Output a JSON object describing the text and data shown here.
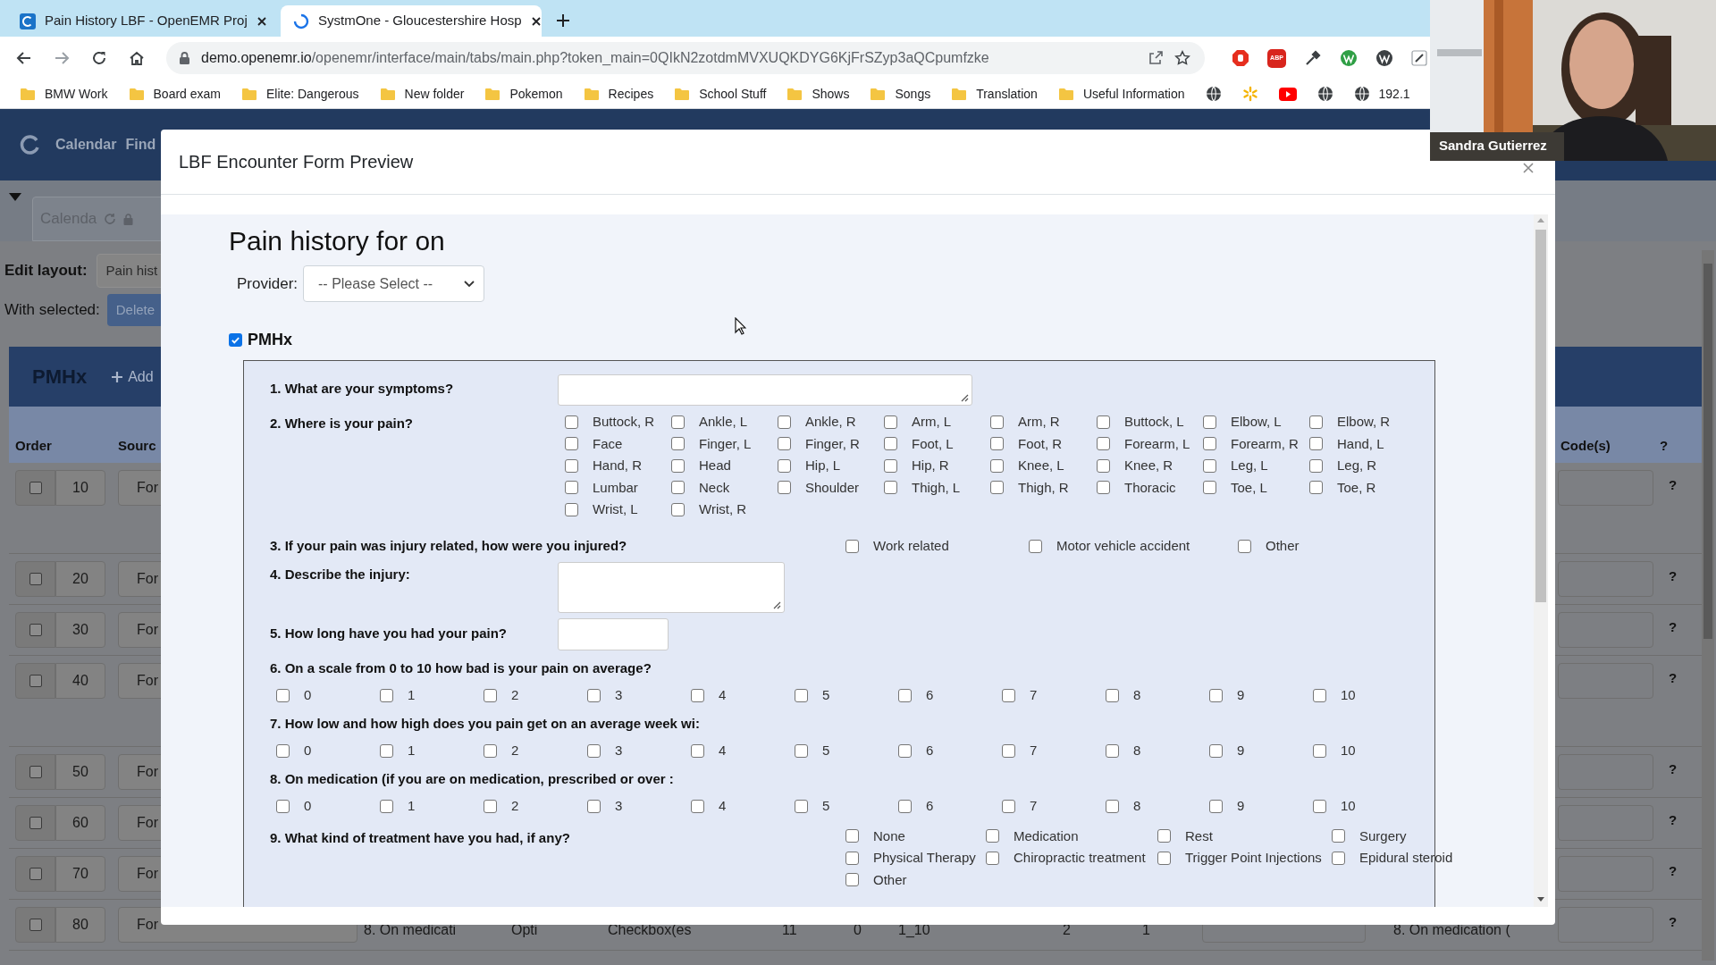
{
  "browser": {
    "tabs": [
      {
        "title": "Pain History LBF - OpenEMR Proj",
        "selected": false
      },
      {
        "title": "SystmOne - Gloucestershire Hosp",
        "selected": true
      }
    ],
    "url_host": "demo.openemr.io",
    "url_path": "/openemr/interface/main/tabs/main.php?token_main=0QIkN2zotdmMVXUQKDYG6KjFrSZyp3aQCpumfzke",
    "abp_label": "ABP",
    "bookmarks": [
      "BMW Work",
      "Board exam",
      "Elite: Dangerous",
      "New folder",
      "Pokemon",
      "Recipes",
      "School Stuff",
      "Shows",
      "Songs",
      "Translation",
      "Useful Information"
    ],
    "bookmark_trailing": "192.1"
  },
  "video": {
    "name": "Sandra Gutierrez"
  },
  "app": {
    "nav": [
      "Calendar",
      "Find"
    ],
    "tab": "Calenda",
    "edit_layout_label": "Edit layout:",
    "layout_select": "Pain hist",
    "with_selected_label": "With selected:",
    "delete_button": "Delete",
    "section_title": "PMHx",
    "add_button": "Add",
    "columns": [
      "Order",
      "Sourc",
      "Code(s)",
      "?"
    ],
    "rows": [
      {
        "order": "10",
        "source": "For",
        "help": "?",
        "tall": true,
        "checked": false
      },
      {
        "order": "20",
        "source": "For",
        "help": "?",
        "tall": false,
        "checked": false
      },
      {
        "order": "30",
        "source": "For",
        "help": "?",
        "tall": false,
        "checked": false
      },
      {
        "order": "40",
        "source": "For",
        "help": "?",
        "tall": true,
        "checked": false
      },
      {
        "order": "50",
        "source": "For",
        "help": "?",
        "tall": false,
        "checked": false
      },
      {
        "order": "60",
        "source": "For",
        "help": "?",
        "tall": false,
        "checked": false
      },
      {
        "order": "70",
        "source": "For",
        "help": "?",
        "tall": false,
        "checked": false
      },
      {
        "order": "80",
        "source": "For",
        "help": "?",
        "tall": false,
        "checked": false,
        "more_cells": [
          "8. On medicati",
          "Opti",
          "Checkbox(es",
          "11",
          "0",
          "1_10",
          "2",
          "1",
          "8. On medication ("
        ]
      }
    ]
  },
  "modal": {
    "title": "LBF Encounter Form Preview",
    "form_title": "Pain history for on",
    "provider_label": "Provider:",
    "provider_select": "-- Please Select --",
    "section": {
      "label": "PMHx",
      "checked": true
    },
    "questions": [
      {
        "kind": "textarea",
        "label": "1. What are your symptoms?"
      },
      {
        "kind": "grid",
        "label": "2. Where is your pain?",
        "options": [
          {
            "label": "Buttock, R",
            "checked": false
          },
          {
            "label": "Ankle, L",
            "checked": false
          },
          {
            "label": "Ankle, R",
            "checked": false
          },
          {
            "label": "Arm, L",
            "checked": false
          },
          {
            "label": "Arm, R",
            "checked": false
          },
          {
            "label": "Buttock, L",
            "checked": false
          },
          {
            "label": "Elbow, L",
            "checked": false
          },
          {
            "label": "Elbow, R",
            "checked": false
          },
          {
            "label": "Face",
            "checked": false
          },
          {
            "label": "Finger, L",
            "checked": false
          },
          {
            "label": "Finger, R",
            "checked": false
          },
          {
            "label": "Foot, L",
            "checked": false
          },
          {
            "label": "Foot, R",
            "checked": false
          },
          {
            "label": "Forearm, L",
            "checked": false
          },
          {
            "label": "Forearm, R",
            "checked": false
          },
          {
            "label": "Hand, L",
            "checked": false
          },
          {
            "label": "Hand, R",
            "checked": false
          },
          {
            "label": "Head",
            "checked": false
          },
          {
            "label": "Hip, L",
            "checked": false
          },
          {
            "label": "Hip, R",
            "checked": false
          },
          {
            "label": "Knee, L",
            "checked": false
          },
          {
            "label": "Knee, R",
            "checked": false
          },
          {
            "label": "Leg, L",
            "checked": false
          },
          {
            "label": "Leg, R",
            "checked": false
          },
          {
            "label": "Lumbar",
            "checked": false
          },
          {
            "label": "Neck",
            "checked": false
          },
          {
            "label": "Shoulder",
            "checked": false
          },
          {
            "label": "Thigh, L",
            "checked": false
          },
          {
            "label": "Thigh, R",
            "checked": false
          },
          {
            "label": "Thoracic",
            "checked": false
          },
          {
            "label": "Toe, L",
            "checked": false
          },
          {
            "label": "Toe, R",
            "checked": false
          },
          {
            "label": "Wrist, L",
            "checked": false
          },
          {
            "label": "Wrist, R",
            "checked": false
          }
        ]
      },
      {
        "kind": "inline",
        "label": "3. If your pain was injury related, how were you injured?",
        "options": [
          {
            "label": "Work related",
            "checked": false
          },
          {
            "label": "Motor vehicle accident",
            "checked": false
          },
          {
            "label": "Other",
            "checked": false
          }
        ]
      },
      {
        "kind": "box",
        "label": "4. Describe the injury:"
      },
      {
        "kind": "text",
        "label": "5. How long have you had your pain?"
      },
      {
        "kind": "scale",
        "label": "6. On a scale from 0 to 10 how bad is your pain on average?",
        "options": [
          {
            "label": "0",
            "checked": false
          },
          {
            "label": "1",
            "checked": false
          },
          {
            "label": "2",
            "checked": false
          },
          {
            "label": "3",
            "checked": false
          },
          {
            "label": "4",
            "checked": false
          },
          {
            "label": "5",
            "checked": false
          },
          {
            "label": "6",
            "checked": false
          },
          {
            "label": "7",
            "checked": false
          },
          {
            "label": "8",
            "checked": false
          },
          {
            "label": "9",
            "checked": false
          },
          {
            "label": "10",
            "checked": false
          }
        ]
      },
      {
        "kind": "scale",
        "label": "7. How low and how high does you pain get on an average week wi:",
        "options": [
          {
            "label": "0",
            "checked": false
          },
          {
            "label": "1",
            "checked": false
          },
          {
            "label": "2",
            "checked": false
          },
          {
            "label": "3",
            "checked": false
          },
          {
            "label": "4",
            "checked": false
          },
          {
            "label": "5",
            "checked": false
          },
          {
            "label": "6",
            "checked": false
          },
          {
            "label": "7",
            "checked": false
          },
          {
            "label": "8",
            "checked": false
          },
          {
            "label": "9",
            "checked": false
          },
          {
            "label": "10",
            "checked": false
          }
        ]
      },
      {
        "kind": "scale",
        "label": "8. On medication (if you are on medication, prescribed or over :",
        "options": [
          {
            "label": "0",
            "checked": false
          },
          {
            "label": "1",
            "checked": false
          },
          {
            "label": "2",
            "checked": false
          },
          {
            "label": "3",
            "checked": false
          },
          {
            "label": "4",
            "checked": false
          },
          {
            "label": "5",
            "checked": false
          },
          {
            "label": "6",
            "checked": false
          },
          {
            "label": "7",
            "checked": false
          },
          {
            "label": "8",
            "checked": false
          },
          {
            "label": "9",
            "checked": false
          },
          {
            "label": "10",
            "checked": false
          }
        ]
      },
      {
        "kind": "list",
        "label": "9. What kind of treatment have you had, if any?",
        "options": [
          {
            "label": "None",
            "checked": false
          },
          {
            "label": "Medication",
            "checked": false
          },
          {
            "label": "Rest",
            "checked": false
          },
          {
            "label": "Surgery",
            "checked": false
          },
          {
            "label": "Physical Therapy",
            "checked": false
          },
          {
            "label": "Chiropractic treatment",
            "checked": false
          },
          {
            "label": "Trigger Point Injections",
            "checked": false
          },
          {
            "label": "Epidural steroid",
            "checked": false
          },
          {
            "label": "Other",
            "checked": false
          }
        ]
      }
    ]
  }
}
